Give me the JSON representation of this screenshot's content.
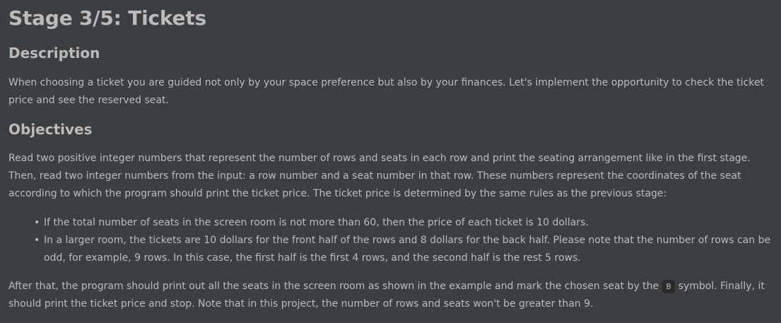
{
  "title": "Stage 3/5: Tickets",
  "description": {
    "heading": "Description",
    "text": "When choosing a ticket you are guided not only by your space preference but also by your finances. Let's implement the opportunity to check the ticket price and see the reserved seat."
  },
  "objectives": {
    "heading": "Objectives",
    "intro": "Read two positive integer numbers that represent the number of rows and seats in each row and print the seating arrangement like in the first stage. Then, read two integer numbers from the input: a row number and a seat number in that row. These numbers represent the coordinates of the seat according to which the program should print the ticket price. The ticket price is determined by the same rules as the previous stage:",
    "bullets": [
      "If the total number of seats in the screen room is not more than 60, then the price of each ticket is 10 dollars.",
      "In a larger room, the tickets are 10 dollars for the front half of the rows and 8 dollars for the back half. Please note that the number of rows can be odd, for example, 9 rows. In this case, the first half is the first 4 rows, and the second half is the rest 5 rows."
    ],
    "after_before_code": "After that, the program should print out all the seats in the screen room as shown in the example and mark the chosen seat by the",
    "code_symbol": "B",
    "after_after_code": "symbol. Finally, it should print the ticket price and stop. Note that in this project, the number of rows and seats won't be greater than 9."
  }
}
